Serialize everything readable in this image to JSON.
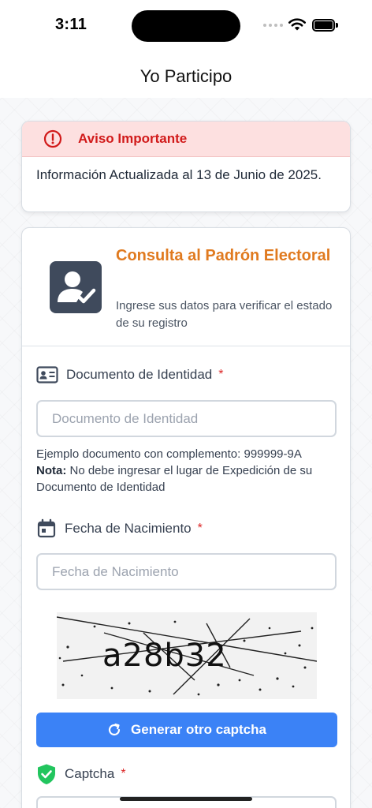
{
  "status_bar": {
    "time": "3:11"
  },
  "header": {
    "title": "Yo Participo"
  },
  "notice": {
    "title": "Aviso Importante",
    "body": "Información Actualizada al 13 de Junio de 2025."
  },
  "card": {
    "title": "Consulta al Padrón Electoral",
    "subtitle": "Ingrese sus datos para verificar el estado de su registro",
    "document": {
      "label": "Documento de Identidad",
      "required_mark": "*",
      "placeholder": "Documento de Identidad",
      "hint_example": "Ejemplo documento con complemento: 999999-9A",
      "hint_note_label": "Nota:",
      "hint_note": " No debe ingresar el lugar de Expedición de su Documento de Identidad"
    },
    "birthdate": {
      "label": "Fecha de Nacimiento",
      "required_mark": "*",
      "placeholder": "Fecha de Nacimiento"
    },
    "captcha": {
      "text": "a28b32",
      "regenerate_label": "Generar otro captcha",
      "label": "Captcha",
      "required_mark": "*"
    }
  },
  "colors": {
    "accent_blue": "#3b82f6",
    "title_orange": "#e07a1f",
    "alert_red": "#d11a1a",
    "captcha_green": "#22c55e"
  },
  "icons": [
    "wifi-icon",
    "battery-icon",
    "alert-circle-icon",
    "user-check-icon",
    "id-card-icon",
    "calendar-icon",
    "refresh-icon",
    "shield-check-icon"
  ]
}
